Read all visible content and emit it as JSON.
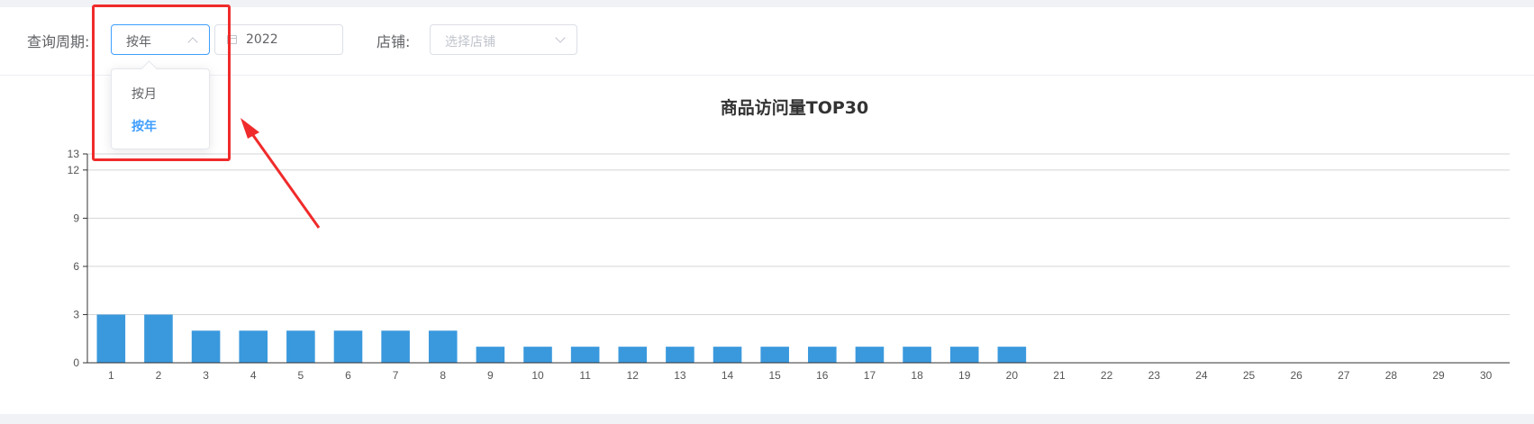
{
  "filters": {
    "period_label": "查询周期:",
    "period_value": "按年",
    "date_value": "2022",
    "store_label": "店铺:",
    "store_placeholder": "选择店铺"
  },
  "dropdown": {
    "options": [
      {
        "label": "按月",
        "selected": false
      },
      {
        "label": "按年",
        "selected": true
      }
    ]
  },
  "colors": {
    "bar": "#3a99dd",
    "accent": "#409eff",
    "annotation": "#f02b2b"
  },
  "chart_data": {
    "type": "bar",
    "title": "商品访问量TOP30",
    "xlabel": "",
    "ylabel": "",
    "categories": [
      "1",
      "2",
      "3",
      "4",
      "5",
      "6",
      "7",
      "8",
      "9",
      "10",
      "11",
      "12",
      "13",
      "14",
      "15",
      "16",
      "17",
      "18",
      "19",
      "20",
      "21",
      "22",
      "23",
      "24",
      "25",
      "26",
      "27",
      "28",
      "29",
      "30"
    ],
    "values": [
      3,
      3,
      2,
      2,
      2,
      2,
      2,
      2,
      1,
      1,
      1,
      1,
      1,
      1,
      1,
      1,
      1,
      1,
      1,
      1,
      0,
      0,
      0,
      0,
      0,
      0,
      0,
      0,
      0,
      0
    ],
    "ylim": [
      0,
      13
    ],
    "yticks": [
      0,
      3,
      6,
      9,
      12,
      13
    ],
    "grid": true
  }
}
